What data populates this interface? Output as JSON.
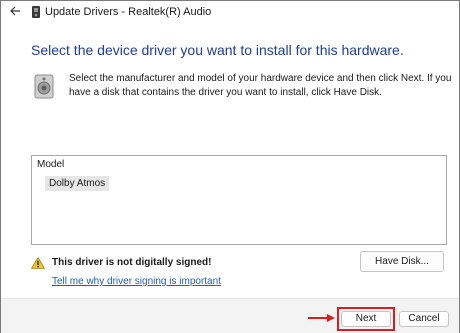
{
  "window": {
    "title": "Update Drivers - Realtek(R) Audio",
    "back_icon": "back-arrow-icon",
    "device_icon": "device-icon"
  },
  "main": {
    "heading": "Select the device driver you want to install for this hardware.",
    "description": "Select the manufacturer and model of your hardware device and then click Next. If you have a disk that contains the driver you want to install, click Have Disk.",
    "speaker_icon": "speaker-icon"
  },
  "model_list": {
    "header": "Model",
    "items": [
      "Dolby Atmos"
    ],
    "selected": "Dolby Atmos"
  },
  "signing": {
    "warning_icon": "warning-icon",
    "warning_text": "This driver is not digitally signed!",
    "help_link": "Tell me why driver signing is important",
    "have_disk_label": "Have Disk..."
  },
  "footer": {
    "next_label": "Next",
    "cancel_label": "Cancel"
  },
  "colors": {
    "heading": "#1f3d9a",
    "link": "#1a5fb4",
    "annotation": "#d81e1e",
    "warning": "#f2c811"
  }
}
